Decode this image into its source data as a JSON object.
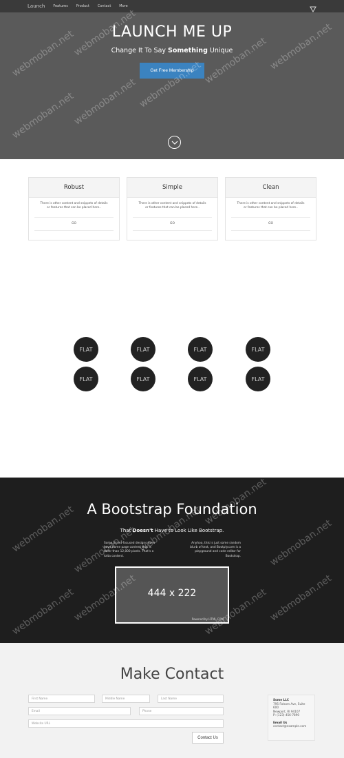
{
  "navbar": {
    "brand": "Launch",
    "links": [
      "Features",
      "Product",
      "Contact",
      "More"
    ]
  },
  "hero": {
    "title": "LAUNCH ME UP",
    "subtitle_pre": "Change It To Say ",
    "subtitle_bold": "Something",
    "subtitle_post": " Unique",
    "button_label": "Get Free Membership"
  },
  "cards": [
    {
      "title": "Robust",
      "text": "There is other content and snippets of details or features that can be placed here..",
      "link": "GO"
    },
    {
      "title": "Simple",
      "text": "There is other content and snippets of details or features that can be placed here..",
      "link": "GO"
    },
    {
      "title": "Clean",
      "text": "There is other content and snippets of details or features that can be placed here..",
      "link": "GO"
    }
  ],
  "flat_label": "FLAT",
  "dark": {
    "title": "A Bootstrap Foundation",
    "sub_pre": "That ",
    "sub_bold": "Doesn't",
    "sub_post": " Have to Look Like Bootstrap.",
    "left_text": "Some brand-focused designs even have home page content that is taller than 12,000 pixels. That's a lotta content.",
    "right_text": "Anyhoo, this is just some random blurb of text, and Bootply.com is a playground and code editor for Bootstrap.",
    "placeholder_label": "444 x 222",
    "placeholder_foot": "Powered by HTML.COM"
  },
  "contact": {
    "title": "Make Contact",
    "placeholders": {
      "first": "First Name",
      "middle": "Middle Name",
      "last": "Last Name",
      "email": "Email",
      "phone": "Phone",
      "website": "Website URL"
    },
    "button_label": "Contact Us",
    "address": {
      "company": "Some LLC",
      "line1": "795 Folsom Ave, Suite 600",
      "line2": "Newport, RI 94107",
      "phone": "P: (123) 456-7890",
      "email_label": "Email Us",
      "email": "contact@example.com"
    }
  },
  "watermark": "webmoban.net",
  "colors": {
    "navbar": "#3a3a3a",
    "hero": "#5a5a5a",
    "primary_button": "#3b83c0",
    "dark_section": "#1e1e1e",
    "contact_bg": "#f2f2f2"
  }
}
